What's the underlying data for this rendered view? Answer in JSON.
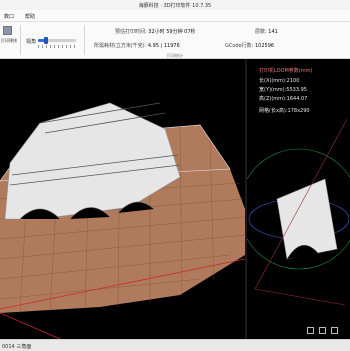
{
  "window": {
    "title": "海豚科技 · 3D打印软件 10.7.35"
  },
  "menu": [
    {
      "label": "数口"
    },
    {
      "label": "帮助"
    }
  ],
  "toolbar": {
    "tool_label": "打印预排",
    "view_label": "视角",
    "slider": {
      "value": 0.2
    }
  },
  "stats": {
    "time_label": "预估打印时间:",
    "time_value": "32小时 59分钟 07秒",
    "layers_label": "层数:",
    "layers_value": "141",
    "material_label": "所需耗材(立方米|千克):",
    "material_value": "4.95 | 11976",
    "gcode_label": "GCode行数:",
    "gcode_value": "102596",
    "section": "打印统计"
  },
  "preview": {
    "title": "打印机LOOM参数(mm)",
    "lines": [
      {
        "text": "长(X)(mm):2100"
      },
      {
        "text": "宽(Y)(mm):5533.95"
      },
      {
        "text": "高(Z)(mm):1644.07"
      },
      {
        "text": "网格(长x高):178x290"
      }
    ]
  },
  "status": {
    "text": "0014 三角面"
  },
  "colors": {
    "accent": "#2f6fe0",
    "bed": "#b07a5c",
    "model": "#e6e6e6",
    "frame": "#9c2f2f"
  }
}
